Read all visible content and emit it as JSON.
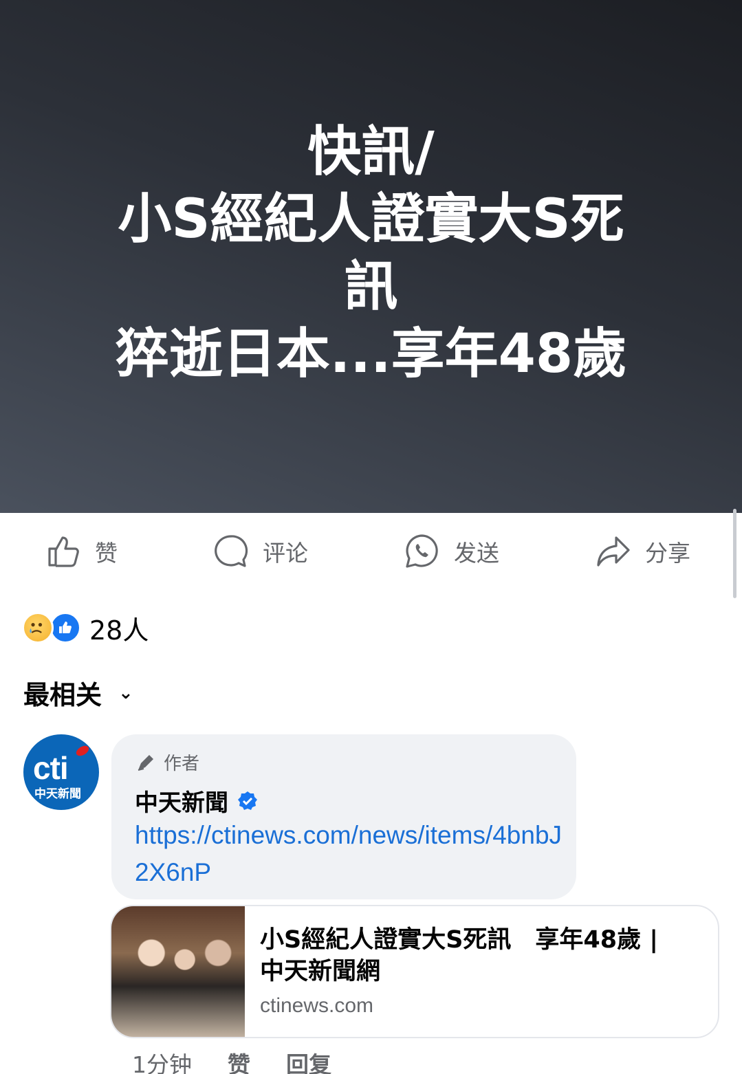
{
  "hero": {
    "lines": [
      "快訊/",
      "小S經紀人證實大S死",
      "訊",
      "猝逝日本...享年48歲"
    ]
  },
  "actions": {
    "like": "赞",
    "comment": "评论",
    "send": "发送",
    "share": "分享"
  },
  "reactions": {
    "count": "28人"
  },
  "sort": {
    "label": "最相关"
  },
  "comment": {
    "author_tag": "作者",
    "author_name": "中天新聞",
    "link_text": "https://ctinews.com/news/items/4bnbJ2X6nP",
    "avatar_text": "cti",
    "avatar_sub": "中天新聞",
    "preview": {
      "title": "小S經紀人證實大S死訊　享年48歲 | 中天新聞網",
      "domain": "ctinews.com"
    },
    "meta": {
      "time": "1分钟",
      "like": "赞",
      "reply": "回复"
    }
  },
  "colors": {
    "link": "#1a6fd6",
    "verified": "#1877f2",
    "secondary_text": "#65676b",
    "bubble": "#f0f2f5"
  }
}
